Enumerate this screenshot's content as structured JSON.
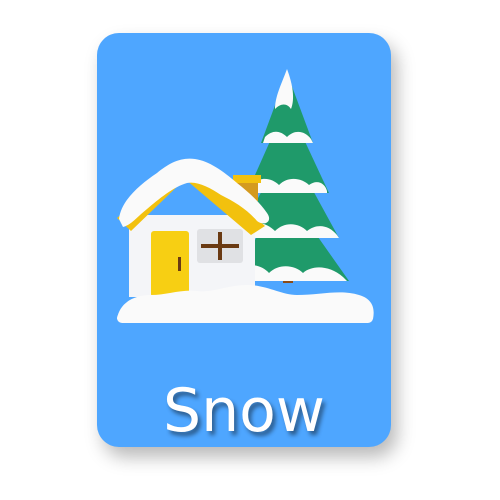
{
  "card": {
    "label": "Snow",
    "background_color": "#4ea6ff",
    "illustration": "snow-covered-house-and-pine-tree"
  },
  "colors": {
    "snow": "#fafafa",
    "roof": "#f2c10e",
    "door": "#f7cf13",
    "tree": "#1f9a6a",
    "trunk": "#8a4b17",
    "chimney": "#d49a1f",
    "window_cross": "#6a3a12"
  }
}
